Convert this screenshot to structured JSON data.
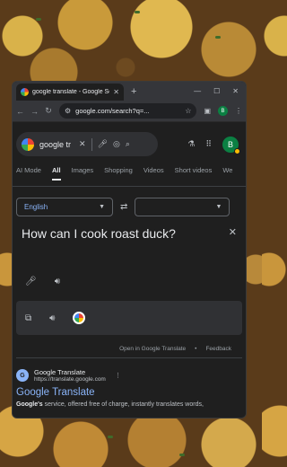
{
  "browser": {
    "tab_title": "google translate - Google Sea",
    "url": "google.com/search?q=...",
    "profile_initial": "B"
  },
  "search": {
    "query": "google tr",
    "avatar_initial": "B"
  },
  "tabs": [
    "AI Mode",
    "All",
    "Images",
    "Shopping",
    "Videos",
    "Short videos",
    "We"
  ],
  "active_tab": "All",
  "translate": {
    "source_lang": "English",
    "target_lang": "",
    "source_text": "How can I cook roast duck?",
    "open_link": "Open in Google Translate",
    "feedback": "Feedback"
  },
  "result": {
    "site_name": "Google Translate",
    "site_url": "https://translate.google.com",
    "title": "Google Translate",
    "snippet_bold": "Google's",
    "snippet_rest": " service, offered free of charge, instantly translates words,"
  },
  "colors": {
    "link": "#8ab4f8",
    "surface": "#1f1f1f",
    "field": "#303134"
  }
}
